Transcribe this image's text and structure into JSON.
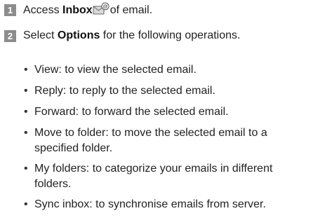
{
  "steps": [
    {
      "number": "1",
      "prefix": "Access ",
      "bold": "Inbox",
      "icon": "inbox-email-icon",
      "suffix": "of email."
    },
    {
      "number": "2",
      "prefix": "Select ",
      "bold": "Options",
      "suffix": " for the following operations."
    }
  ],
  "options": [
    "View: to view the selected email.",
    "Reply: to reply to the selected email.",
    "Forward: to forward the selected email.",
    "Move to folder: to move the selected email to a specified folder.",
    "My folders: to categorize your emails in different folders.",
    "Sync inbox: to synchronise emails from server."
  ],
  "colors": {
    "step_badge": "#8c8c8c",
    "text": "#222222"
  }
}
